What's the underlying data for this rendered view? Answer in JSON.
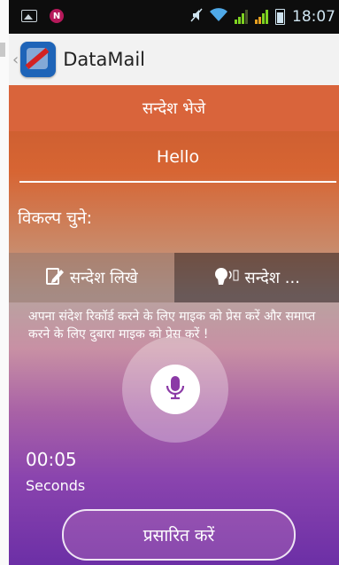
{
  "status_bar": {
    "left_icons": [
      "image-icon",
      "notification-n-icon"
    ],
    "n_badge": "N",
    "right_icons": [
      "mute-icon",
      "wifi-icon",
      "signal-icon-1",
      "signal-icon-2",
      "battery-icon"
    ],
    "time": "18:07"
  },
  "app_bar": {
    "back_glyph": "‹",
    "logo_icon": "datamail-logo-icon",
    "title": "DataMail"
  },
  "screen": {
    "header": "सन्देश भेजे",
    "message_value": "Hello",
    "options_label": "विकल्प चुने:",
    "tabs": [
      {
        "label": "सन्देश लिखे",
        "icon": "write-icon"
      },
      {
        "label": "सन्देश ...",
        "icon": "voice-icon"
      }
    ],
    "instructions": "अपना संदेश रिकॉर्ड करने के लिए माइक को प्रेस करें और समाप्त करने के लिए दुबारा माइक को प्रेस करें !",
    "mic_icon": "microphone-icon",
    "timer": "00:05",
    "timer_unit": "Seconds",
    "broadcast_button": "प्रसारित करें"
  },
  "colors": {
    "header_orange": "#d9643b",
    "mic_purple": "#8b3aa6",
    "gradient_bottom": "#6c2fa6"
  }
}
